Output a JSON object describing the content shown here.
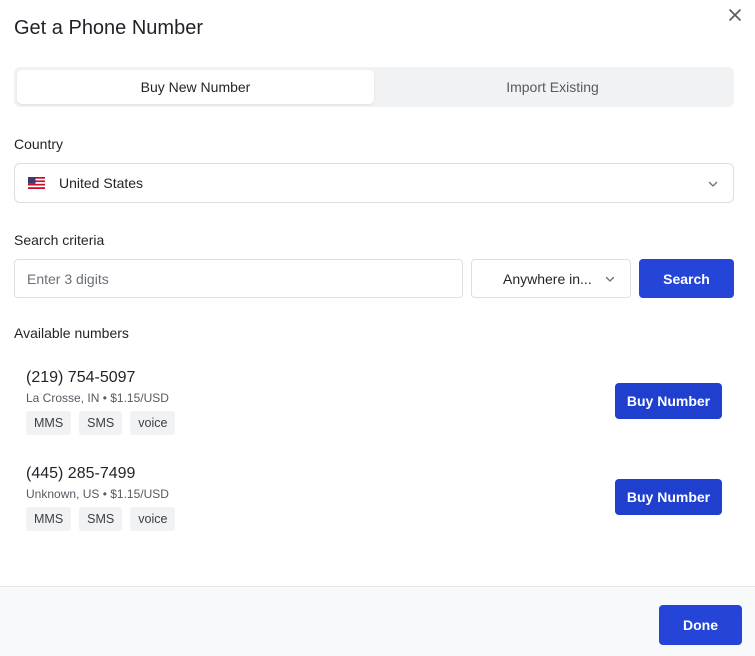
{
  "dialog": {
    "title": "Get a Phone Number",
    "close_icon": "close-icon"
  },
  "tabs": [
    {
      "label": "Buy New Number",
      "active": true
    },
    {
      "label": "Import Existing",
      "active": false
    }
  ],
  "country": {
    "label": "Country",
    "value": "United States",
    "flag_icon": "us-flag-icon"
  },
  "search": {
    "label": "Search criteria",
    "placeholder": "Enter 3 digits",
    "location_value": "Anywhere in...",
    "button_label": "Search"
  },
  "available": {
    "label": "Available numbers",
    "numbers": [
      {
        "number": "(219) 754-5097",
        "meta": "La Crosse, IN • $1.15/USD",
        "tags": [
          "MMS",
          "SMS",
          "voice"
        ],
        "button_label": "Buy Number"
      },
      {
        "number": "(445) 285-7499",
        "meta": "Unknown, US • $1.15/USD",
        "tags": [
          "MMS",
          "SMS",
          "voice"
        ],
        "button_label": "Buy Number"
      }
    ]
  },
  "footer": {
    "done_label": "Done"
  },
  "colors": {
    "primary": "#2545d9",
    "tag_bg": "#f1f2f4",
    "footer_bg": "#f8f9fa"
  }
}
